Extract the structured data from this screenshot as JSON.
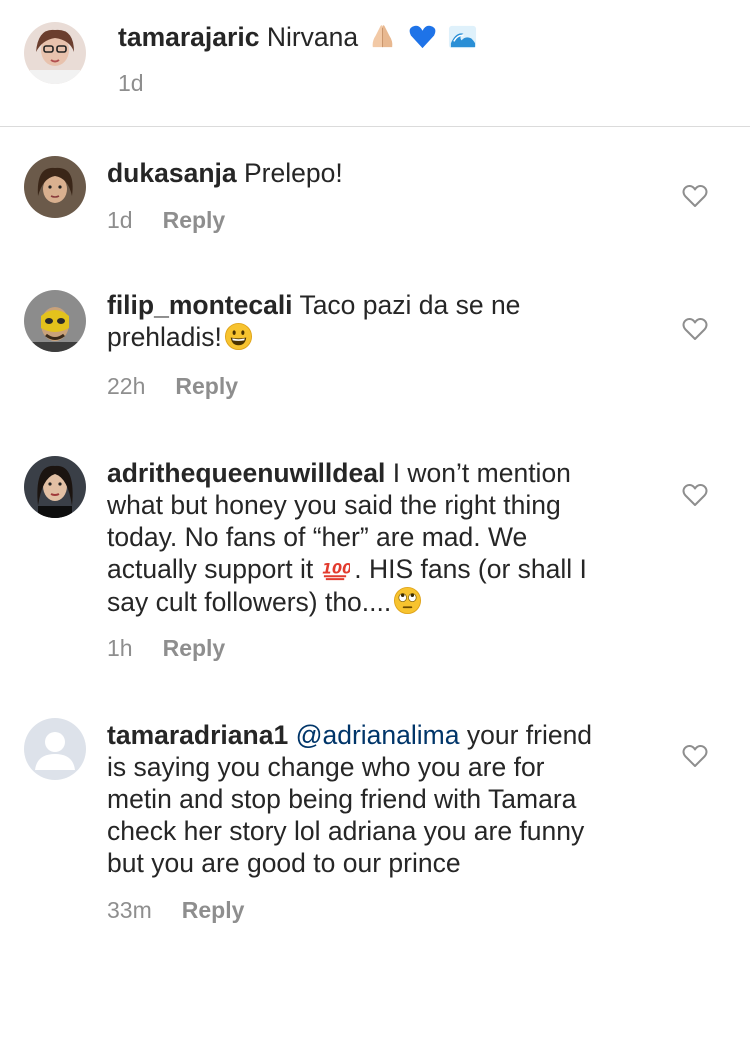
{
  "caption": {
    "username": "tamarajaric",
    "text": "Nirvana",
    "emojis": [
      "praying-hands-emoji",
      "blue-heart-emoji",
      "water-wave-emoji"
    ],
    "time": "1d"
  },
  "comments": [
    {
      "username": "dukasanja",
      "text": "Prelepo!",
      "time": "1d",
      "reply_label": "Reply"
    },
    {
      "username": "filip_montecali",
      "text_1": "Taco pazi da se ne",
      "text_2": "prehladis!",
      "emoji": "grinning-face-emoji",
      "time": "22h",
      "reply_label": "Reply"
    },
    {
      "username": "adrithequeenuwilldeal",
      "text_1": "I won’t mention",
      "line_2": "what but honey you said the right thing",
      "line_3": "today. No fans of “her” are mad. We",
      "line_4a": "actually support it",
      "line_4b": ". HIS fans (or shall I",
      "line_5": "say cult followers) tho....",
      "emojis": [
        "hundred-points-emoji",
        "eye-roll-emoji"
      ],
      "time": "1h",
      "reply_label": "Reply"
    },
    {
      "username": "tamaradriana1",
      "mention": "@adrianalima",
      "text_1": "your friend",
      "line_2": "is saying you change who you are for",
      "line_3": "metin and stop being friend with Tamara",
      "line_4": "check her story lol adriana you are funny",
      "line_5": "but you are good to our prince",
      "time": "33m",
      "reply_label": "Reply"
    }
  ],
  "colors": {
    "text": "#262626",
    "meta": "#8e8e8e",
    "mention": "#003569",
    "divider": "#dbdbdb"
  }
}
